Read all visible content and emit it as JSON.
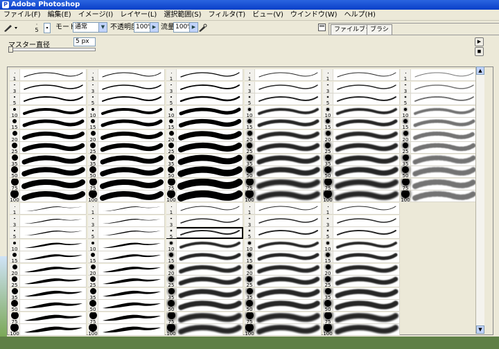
{
  "window": {
    "title": "Adobe Photoshop"
  },
  "menu": [
    "ファイル(F)",
    "編集(E)",
    "イメージ(I)",
    "レイヤー(L)",
    "選択範囲(S)",
    "フィルタ(T)",
    "ビュー(V)",
    "ウインドウ(W)",
    "ヘルプ(H)"
  ],
  "options": {
    "brush_size": "5",
    "mode_label": "モード:",
    "mode_value": "通常",
    "opacity_label": "不透明度:",
    "opacity_value": "100%",
    "flow_label": "流量:",
    "flow_value": "100%"
  },
  "tabs": [
    "ファイルブラウザ",
    "ブラシ"
  ],
  "brush_panel": {
    "master_label": "マスター直径",
    "master_value": "5 px"
  },
  "sizes": [
    "1",
    "3",
    "5",
    "10",
    "15",
    "20",
    "25",
    "35",
    "50",
    "75",
    "100"
  ],
  "colors": {
    "titlebar": "#1d4fd0",
    "selection": "#000000"
  }
}
